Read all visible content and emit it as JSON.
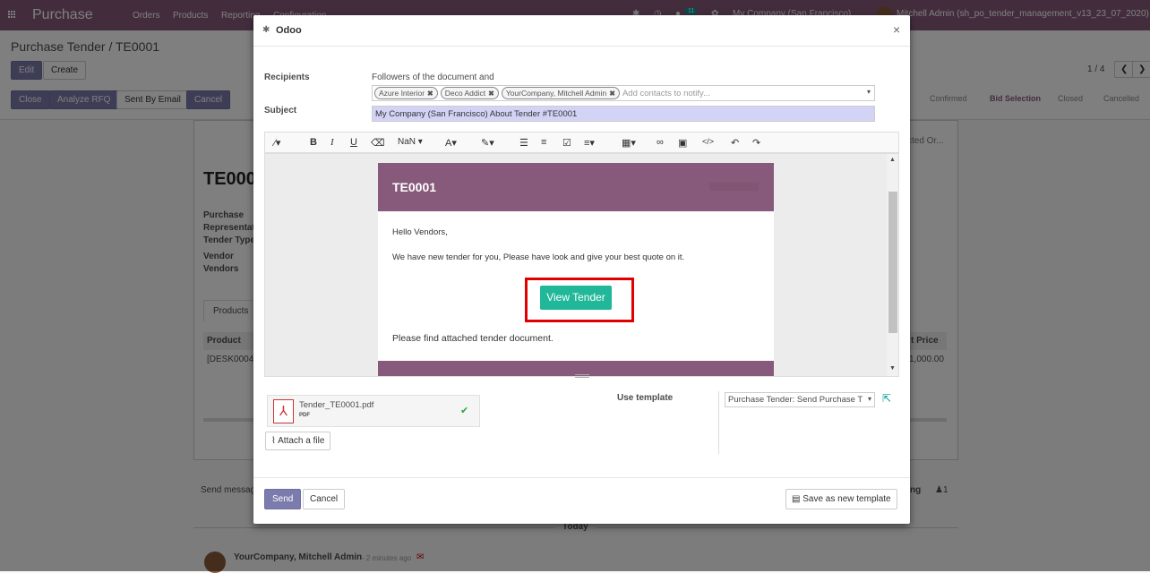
{
  "app": {
    "brand": "Purchase",
    "menu": [
      "Orders",
      "Products",
      "Reporting",
      "Configuration"
    ],
    "badge": "11",
    "company": "My Company (San Francisco)",
    "user": "Mitchell Admin (sh_po_tender_management_v13_23_07_2020)"
  },
  "breadcrumb": "Purchase Tender / TE0001",
  "actions": {
    "edit": "Edit",
    "create": "Create",
    "pager": "1 / 4"
  },
  "status_buttons": [
    "Close",
    "Analyze RFQ",
    "Sent By Email",
    "Cancel"
  ],
  "stages": [
    "Confirmed",
    "Bid Selection",
    "Closed",
    "Cancelled"
  ],
  "stage_active": "Bid Selection",
  "form": {
    "title": "TE000",
    "labels": [
      "Purchase",
      "Representat",
      "Tender Type",
      "Vendor",
      "Vendors"
    ],
    "tab": "Products",
    "col_product": "Product",
    "col_price": "t Price",
    "row_product": "[DESK0004]",
    "row_price": "1,000.00",
    "selected_order": "cted Or..."
  },
  "chatter": {
    "send_message": "Send messag",
    "log": "ng",
    "followers": "1",
    "today": "Today",
    "author": "YourCompany, Mitchell Admin",
    "time": "- 2 minutes ago"
  },
  "dialog": {
    "title": "Odoo",
    "recipients_label": "Recipients",
    "followers_text": "Followers of the document and",
    "recipients": [
      "Azure Interior",
      "Deco Addict",
      "YourCompany, Mitchell Admin"
    ],
    "recipients_placeholder": "Add contacts to notify...",
    "subject_label": "Subject",
    "subject_value": "My Company (San Francisco) About Tender #TE0001",
    "toolbar": {
      "font_size": "NaN"
    },
    "email": {
      "header": "TE0001",
      "greeting": "Hello Vendors,",
      "body": "We have new tender for you, Please have look and give your best quote on it.",
      "cta": "View Tender",
      "footer_text": "Please find attached tender document."
    },
    "attachment": {
      "name": "Tender_TE0001.pdf",
      "type": "PDF"
    },
    "attach_label": "Attach a file",
    "template_label": "Use template",
    "template_value": "Purchase Tender: Send Purchase T",
    "send": "Send",
    "cancel": "Cancel",
    "save_template": "Save as new template"
  },
  "colors": {
    "brand": "#875a7b",
    "primary": "#7c7bad",
    "cta": "#21b799",
    "highlight": "#e00000"
  }
}
